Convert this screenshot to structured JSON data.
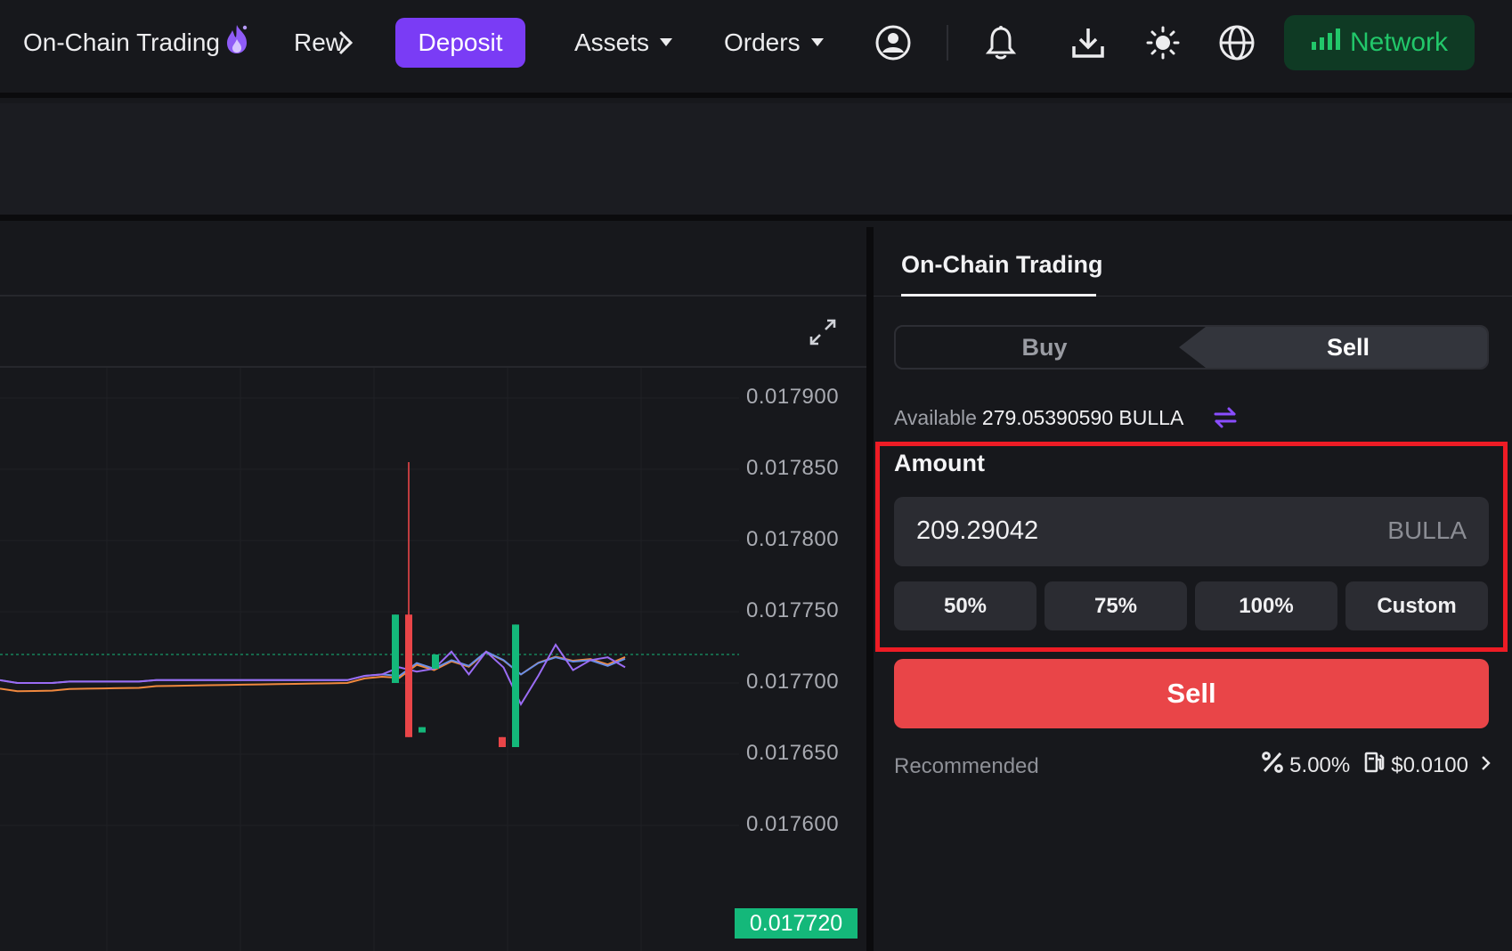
{
  "nav": {
    "brand": "On-Chain Trading",
    "rewards_truncated": "Rew",
    "deposit": "Deposit",
    "assets": "Assets",
    "orders": "Orders",
    "network": "Network"
  },
  "icons": {
    "flame": "flame-icon",
    "chevron": "chevron-right-icon",
    "account": "user-circle-icon",
    "bell": "bell-icon",
    "download": "download-icon",
    "theme": "sun-icon",
    "language": "globe-icon",
    "signal": "signal-bars-icon",
    "expand": "expand-icon",
    "swap": "swap-arrows-icon",
    "slippage": "percent-icon",
    "gas": "gas-pump-icon"
  },
  "colors": {
    "accent_purple": "#7a3cf5",
    "up_green": "#14b87a",
    "down_red": "#e94548",
    "network_green": "#22c76a",
    "highlight_red": "#ee1c25"
  },
  "chart": {
    "price_axis": [
      "0.017900",
      "0.017850",
      "0.017800",
      "0.017750",
      "0.017700",
      "0.017650",
      "0.017600"
    ],
    "current_price": "0.017720"
  },
  "chart_data": {
    "type": "candlestick",
    "ylim": [
      0.01758,
      0.01792
    ],
    "current_price": 0.01772,
    "candles": [
      {
        "t": 22,
        "o": 0.0177,
        "c": 0.017748,
        "h": 0.017748,
        "l": 0.0177,
        "dir": "up"
      },
      {
        "t": 23,
        "o": 0.017748,
        "c": 0.017662,
        "h": 0.017855,
        "l": 0.017662,
        "dir": "down"
      },
      {
        "t": 24,
        "o": 0.017669,
        "c": 0.017666,
        "h": 0.017669,
        "l": 0.017666,
        "dir": "up"
      },
      {
        "t": 25,
        "o": 0.01771,
        "c": 0.01772,
        "h": 0.01772,
        "l": 0.01771,
        "dir": "up"
      },
      {
        "t": 30,
        "o": 0.017662,
        "c": 0.017655,
        "h": 0.017662,
        "l": 0.017655,
        "dir": "down"
      },
      {
        "t": 31,
        "o": 0.017655,
        "c": 0.017741,
        "h": 0.017741,
        "l": 0.017655,
        "dir": "up"
      }
    ]
  },
  "trade": {
    "tab": "On-Chain Trading",
    "buy": "Buy",
    "sell_tab": "Sell",
    "available_label": "Available",
    "available_value": "279.05390590 BULLA",
    "amount_label": "Amount",
    "amount_value": "209.29042",
    "amount_unit": "BULLA",
    "pct": [
      "50%",
      "75%",
      "100%",
      "Custom"
    ],
    "sell_button": "Sell",
    "recommended": "Recommended",
    "slippage": "5.00%",
    "gas": "$0.0100"
  }
}
